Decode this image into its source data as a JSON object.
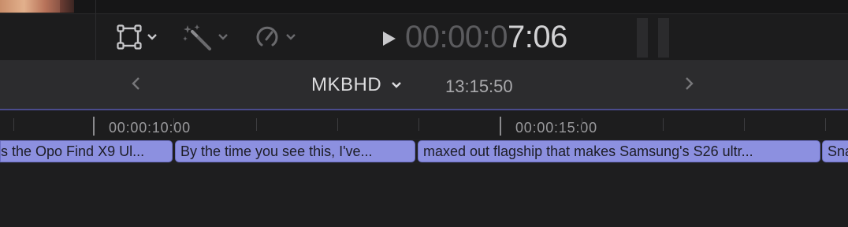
{
  "toolbar": {
    "timecode_dim": "00:00:0",
    "timecode_bright": "7:06"
  },
  "navigator": {
    "project_name": "MKBHD",
    "duration": "13:15:50"
  },
  "ruler": {
    "labels": [
      "00:00:10:00",
      "00:00:15:00"
    ]
  },
  "captions": [
    {
      "text": "s the Opo Find X9 Ul..."
    },
    {
      "text": "By the time you see this, I've..."
    },
    {
      "text": "maxed out flagship that makes Samsung's S26 ultr..."
    },
    {
      "text": "Sna"
    }
  ],
  "colors": {
    "caption_clip": "#8c90e0",
    "playhead_line": "#4a4b8c",
    "timecode_bright": "#d2d2d4"
  },
  "icons": [
    "transform-icon",
    "magic-wand-icon",
    "speed-icon",
    "play-icon",
    "chevron-left-icon",
    "chevron-right-icon"
  ]
}
